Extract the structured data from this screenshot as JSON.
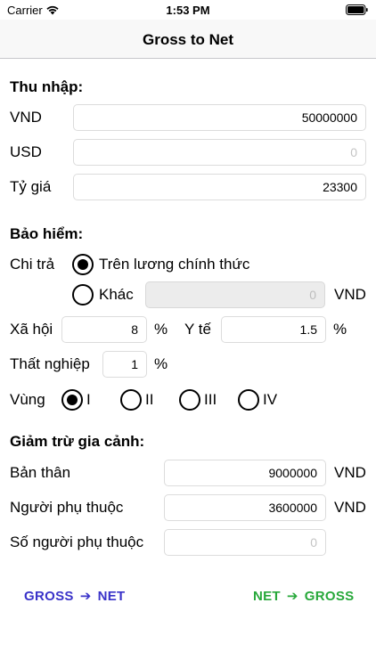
{
  "status": {
    "carrier": "Carrier",
    "time": "1:53 PM"
  },
  "nav": {
    "title": "Gross to Net"
  },
  "income": {
    "title": "Thu nhập:",
    "vnd_label": "VND",
    "vnd_value": "50000000",
    "usd_label": "USD",
    "usd_value": "0",
    "rate_label": "Tỷ giá",
    "rate_value": "23300"
  },
  "insurance": {
    "title": "Bảo hiểm:",
    "pay_label": "Chi trả",
    "official_salary_label": "Trên lương chính thức",
    "official_salary_selected": true,
    "other_label": "Khác",
    "other_value": "0",
    "other_unit": "VND",
    "social_label": "Xã hội",
    "social_value": "8",
    "social_unit": "%",
    "health_label": "Y tế",
    "health_value": "1.5",
    "health_unit": "%",
    "unemployment_label": "Thất nghiệp",
    "unemployment_value": "1",
    "unemployment_unit": "%",
    "region_label": "Vùng",
    "regions": [
      {
        "label": "I",
        "selected": true
      },
      {
        "label": "II",
        "selected": false
      },
      {
        "label": "III",
        "selected": false
      },
      {
        "label": "IV",
        "selected": false
      }
    ]
  },
  "deduction": {
    "title": "Giảm trừ gia cảnh:",
    "self_label": "Bản thân",
    "self_value": "9000000",
    "self_unit": "VND",
    "dependent_label": "Người phụ thuộc",
    "dependent_value": "3600000",
    "dependent_unit": "VND",
    "dependent_count_label": "Số người phụ thuộc",
    "dependent_count_value": "0"
  },
  "actions": {
    "gross_to_net": {
      "from": "GROSS",
      "arrow": "➔",
      "to": "NET",
      "color": "#3a33c9"
    },
    "net_to_gross": {
      "from": "NET",
      "arrow": "➔",
      "to": "GROSS",
      "color": "#27a83a"
    }
  },
  "icons": {
    "wifi": "wifi-icon",
    "battery": "battery-icon"
  }
}
